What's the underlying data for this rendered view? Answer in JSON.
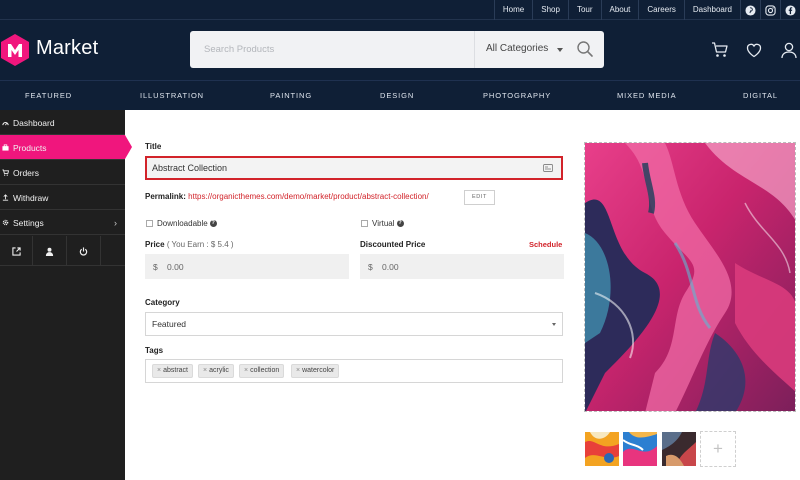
{
  "top_links": [
    "Home",
    "Shop",
    "Tour",
    "About",
    "Careers",
    "Dashboard"
  ],
  "social_icons": [
    "pinterest-icon",
    "instagram-icon",
    "facebook-icon"
  ],
  "brand": {
    "name": "Market",
    "color": "#f0167d"
  },
  "search": {
    "placeholder": "Search Products",
    "category": "All Categories"
  },
  "header_icons": [
    "cart-icon",
    "heart-icon",
    "user-icon"
  ],
  "categories": [
    "FEATURED",
    "ILLUSTRATION",
    "PAINTING",
    "DESIGN",
    "PHOTOGRAPHY",
    "MIXED MEDIA",
    "DIGITAL"
  ],
  "sidebar": {
    "items": [
      {
        "label": "Dashboard",
        "icon": "dashboard-icon",
        "active": false
      },
      {
        "label": "Products",
        "icon": "briefcase-icon",
        "active": true
      },
      {
        "label": "Orders",
        "icon": "cart-icon",
        "active": false
      },
      {
        "label": "Withdraw",
        "icon": "upload-icon",
        "active": false
      },
      {
        "label": "Settings",
        "icon": "gear-icon",
        "active": false
      }
    ],
    "bottom_icons": [
      "external-link-icon",
      "user-icon",
      "power-icon"
    ]
  },
  "form": {
    "title_label": "Title",
    "title_value": "Abstract Collection",
    "permalink_label": "Permalink:",
    "permalink_url": "https://organicthemes.com/demo/market/product/abstract-collection/",
    "edit_label": "EDIT",
    "downloadable_label": "Downloadable",
    "virtual_label": "Virtual",
    "price_label": "Price",
    "price_earn": "( You Earn : $ 5.4 )",
    "discounted_label": "Discounted Price",
    "schedule_label": "Schedule",
    "currency": "$",
    "price_value": "0.00",
    "discounted_value": "0.00",
    "category_label": "Category",
    "category_value": "Featured",
    "tags_label": "Tags",
    "tags": [
      "abstract",
      "acrylic",
      "collection",
      "watercolor"
    ]
  },
  "colors": {
    "accent": "#f0167d",
    "header": "#0f1f36",
    "error": "#d2232a",
    "sidebar": "#1f1f1f"
  }
}
